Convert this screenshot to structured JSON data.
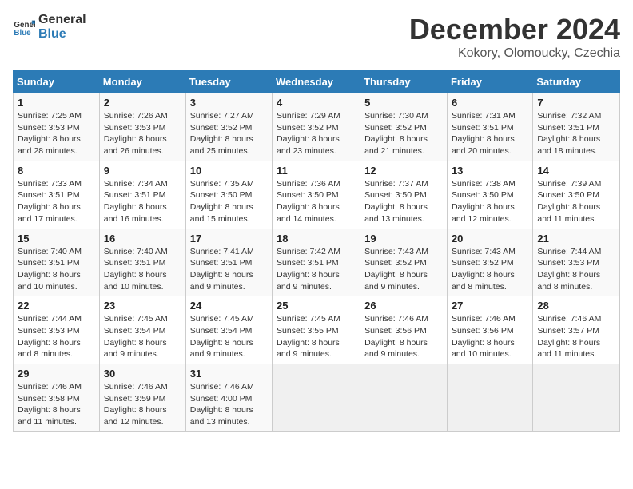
{
  "header": {
    "logo_general": "General",
    "logo_blue": "Blue",
    "month_year": "December 2024",
    "location": "Kokory, Olomoucky, Czechia"
  },
  "days_of_week": [
    "Sunday",
    "Monday",
    "Tuesday",
    "Wednesday",
    "Thursday",
    "Friday",
    "Saturday"
  ],
  "weeks": [
    [
      {
        "day": "1",
        "sunrise": "7:25 AM",
        "sunset": "3:53 PM",
        "daylight": "8 hours and 28 minutes."
      },
      {
        "day": "2",
        "sunrise": "7:26 AM",
        "sunset": "3:53 PM",
        "daylight": "8 hours and 26 minutes."
      },
      {
        "day": "3",
        "sunrise": "7:27 AM",
        "sunset": "3:52 PM",
        "daylight": "8 hours and 25 minutes."
      },
      {
        "day": "4",
        "sunrise": "7:29 AM",
        "sunset": "3:52 PM",
        "daylight": "8 hours and 23 minutes."
      },
      {
        "day": "5",
        "sunrise": "7:30 AM",
        "sunset": "3:52 PM",
        "daylight": "8 hours and 21 minutes."
      },
      {
        "day": "6",
        "sunrise": "7:31 AM",
        "sunset": "3:51 PM",
        "daylight": "8 hours and 20 minutes."
      },
      {
        "day": "7",
        "sunrise": "7:32 AM",
        "sunset": "3:51 PM",
        "daylight": "8 hours and 18 minutes."
      }
    ],
    [
      {
        "day": "8",
        "sunrise": "7:33 AM",
        "sunset": "3:51 PM",
        "daylight": "8 hours and 17 minutes."
      },
      {
        "day": "9",
        "sunrise": "7:34 AM",
        "sunset": "3:51 PM",
        "daylight": "8 hours and 16 minutes."
      },
      {
        "day": "10",
        "sunrise": "7:35 AM",
        "sunset": "3:50 PM",
        "daylight": "8 hours and 15 minutes."
      },
      {
        "day": "11",
        "sunrise": "7:36 AM",
        "sunset": "3:50 PM",
        "daylight": "8 hours and 14 minutes."
      },
      {
        "day": "12",
        "sunrise": "7:37 AM",
        "sunset": "3:50 PM",
        "daylight": "8 hours and 13 minutes."
      },
      {
        "day": "13",
        "sunrise": "7:38 AM",
        "sunset": "3:50 PM",
        "daylight": "8 hours and 12 minutes."
      },
      {
        "day": "14",
        "sunrise": "7:39 AM",
        "sunset": "3:50 PM",
        "daylight": "8 hours and 11 minutes."
      }
    ],
    [
      {
        "day": "15",
        "sunrise": "7:40 AM",
        "sunset": "3:51 PM",
        "daylight": "8 hours and 10 minutes."
      },
      {
        "day": "16",
        "sunrise": "7:40 AM",
        "sunset": "3:51 PM",
        "daylight": "8 hours and 10 minutes."
      },
      {
        "day": "17",
        "sunrise": "7:41 AM",
        "sunset": "3:51 PM",
        "daylight": "8 hours and 9 minutes."
      },
      {
        "day": "18",
        "sunrise": "7:42 AM",
        "sunset": "3:51 PM",
        "daylight": "8 hours and 9 minutes."
      },
      {
        "day": "19",
        "sunrise": "7:43 AM",
        "sunset": "3:52 PM",
        "daylight": "8 hours and 9 minutes."
      },
      {
        "day": "20",
        "sunrise": "7:43 AM",
        "sunset": "3:52 PM",
        "daylight": "8 hours and 8 minutes."
      },
      {
        "day": "21",
        "sunrise": "7:44 AM",
        "sunset": "3:53 PM",
        "daylight": "8 hours and 8 minutes."
      }
    ],
    [
      {
        "day": "22",
        "sunrise": "7:44 AM",
        "sunset": "3:53 PM",
        "daylight": "8 hours and 8 minutes."
      },
      {
        "day": "23",
        "sunrise": "7:45 AM",
        "sunset": "3:54 PM",
        "daylight": "8 hours and 9 minutes."
      },
      {
        "day": "24",
        "sunrise": "7:45 AM",
        "sunset": "3:54 PM",
        "daylight": "8 hours and 9 minutes."
      },
      {
        "day": "25",
        "sunrise": "7:45 AM",
        "sunset": "3:55 PM",
        "daylight": "8 hours and 9 minutes."
      },
      {
        "day": "26",
        "sunrise": "7:46 AM",
        "sunset": "3:56 PM",
        "daylight": "8 hours and 9 minutes."
      },
      {
        "day": "27",
        "sunrise": "7:46 AM",
        "sunset": "3:56 PM",
        "daylight": "8 hours and 10 minutes."
      },
      {
        "day": "28",
        "sunrise": "7:46 AM",
        "sunset": "3:57 PM",
        "daylight": "8 hours and 11 minutes."
      }
    ],
    [
      {
        "day": "29",
        "sunrise": "7:46 AM",
        "sunset": "3:58 PM",
        "daylight": "8 hours and 11 minutes."
      },
      {
        "day": "30",
        "sunrise": "7:46 AM",
        "sunset": "3:59 PM",
        "daylight": "8 hours and 12 minutes."
      },
      {
        "day": "31",
        "sunrise": "7:46 AM",
        "sunset": "4:00 PM",
        "daylight": "8 hours and 13 minutes."
      },
      null,
      null,
      null,
      null
    ]
  ]
}
